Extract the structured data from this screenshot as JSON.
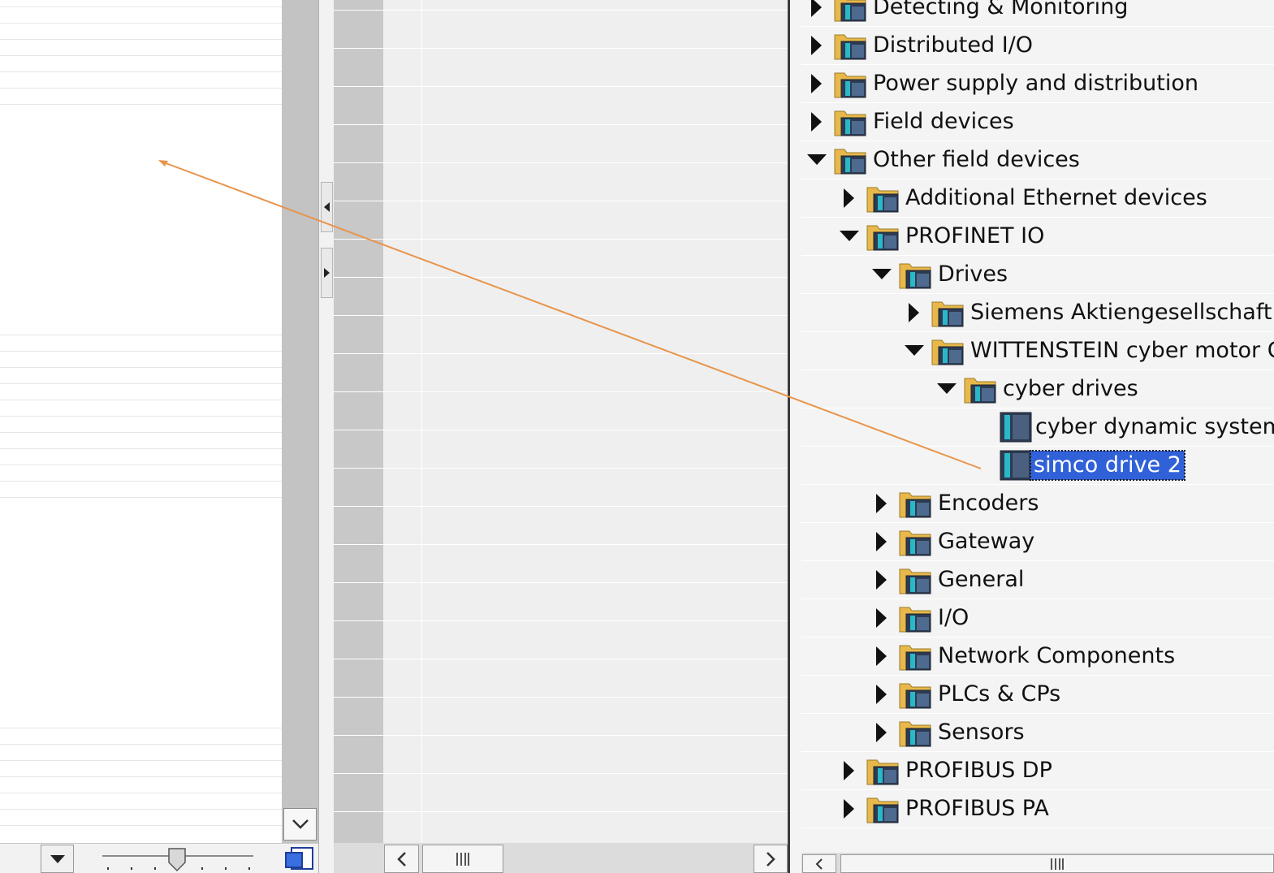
{
  "catalog": {
    "items": [
      {
        "label": "Detecting & Monitoring",
        "toggle": "collapsed",
        "icon": "folder-icon"
      },
      {
        "label": "Distributed I/O",
        "toggle": "collapsed",
        "icon": "folder-icon"
      },
      {
        "label": "Power supply and distribution",
        "toggle": "collapsed",
        "icon": "folder-icon"
      },
      {
        "label": "Field devices",
        "toggle": "collapsed",
        "icon": "folder-icon"
      },
      {
        "label": "Other field devices",
        "toggle": "expanded",
        "icon": "folder-icon"
      },
      {
        "label": "Additional Ethernet devices",
        "toggle": "collapsed",
        "icon": "folder-icon"
      },
      {
        "label": "PROFINET IO",
        "toggle": "expanded",
        "icon": "folder-icon"
      },
      {
        "label": "Drives",
        "toggle": "expanded",
        "icon": "folder-icon"
      },
      {
        "label": "Siemens Aktiengesellschaft",
        "toggle": "collapsed",
        "icon": "folder-icon"
      },
      {
        "label": "WITTENSTEIN cyber motor Gr",
        "toggle": "expanded",
        "icon": "folder-icon"
      },
      {
        "label": "cyber drives",
        "toggle": "expanded",
        "icon": "folder-icon"
      },
      {
        "label": "cyber dynamic system",
        "toggle": "none",
        "icon": "device-icon"
      },
      {
        "label": "simco drive 2",
        "toggle": "none",
        "icon": "device-icon",
        "selected": true
      },
      {
        "label": "Encoders",
        "toggle": "collapsed",
        "icon": "folder-icon"
      },
      {
        "label": "Gateway",
        "toggle": "collapsed",
        "icon": "folder-icon"
      },
      {
        "label": "General",
        "toggle": "collapsed",
        "icon": "folder-icon"
      },
      {
        "label": "I/O",
        "toggle": "collapsed",
        "icon": "folder-icon"
      },
      {
        "label": "Network Components",
        "toggle": "collapsed",
        "icon": "folder-icon"
      },
      {
        "label": "PLCs & CPs",
        "toggle": "collapsed",
        "icon": "folder-icon"
      },
      {
        "label": "Sensors",
        "toggle": "collapsed",
        "icon": "folder-icon"
      },
      {
        "label": "PROFIBUS DP",
        "toggle": "collapsed",
        "icon": "folder-icon"
      },
      {
        "label": "PROFIBUS PA",
        "toggle": "collapsed",
        "icon": "folder-icon"
      }
    ]
  },
  "colors": {
    "selection": "#3161d8",
    "drag_line": "#e8944a",
    "folder": "#e8b84a",
    "device": "#2ab8c8"
  },
  "icons": {
    "scroll_down": "chevron-down-icon",
    "scroll_left": "chevron-left-icon",
    "scroll_right": "chevron-right-icon",
    "dropdown": "caret-down-icon",
    "overview": "overview-icon",
    "zoom": "zoom-slider-thumb-icon"
  }
}
